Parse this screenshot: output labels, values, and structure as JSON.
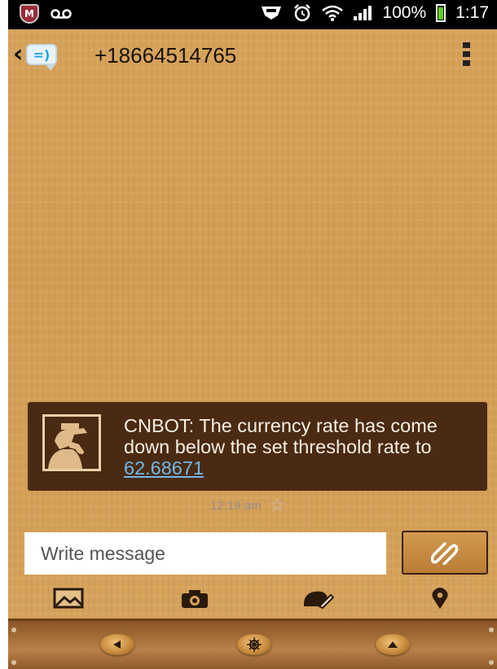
{
  "status_bar": {
    "battery": "100%",
    "time": "1:17",
    "shield_letter": "M"
  },
  "header": {
    "contact": "+18664514765",
    "app_icon_text": "=)"
  },
  "message": {
    "text": "CNBOT: The currency rate has come down below the set threshold rate to ",
    "link": "62.68671",
    "timestamp": "12:19 am"
  },
  "compose": {
    "placeholder": "Write message",
    "value": ""
  },
  "toolbar": {
    "icons": [
      "image-icon",
      "camera-icon",
      "doodle-icon",
      "location-icon"
    ]
  },
  "bottom_nav": {
    "icons": [
      "back-nav-icon",
      "home-wheel-icon",
      "menu-nav-icon"
    ]
  },
  "colors": {
    "message_bg": "#4a2a12",
    "link": "#6fb8ea",
    "wood": "#d4a158"
  }
}
